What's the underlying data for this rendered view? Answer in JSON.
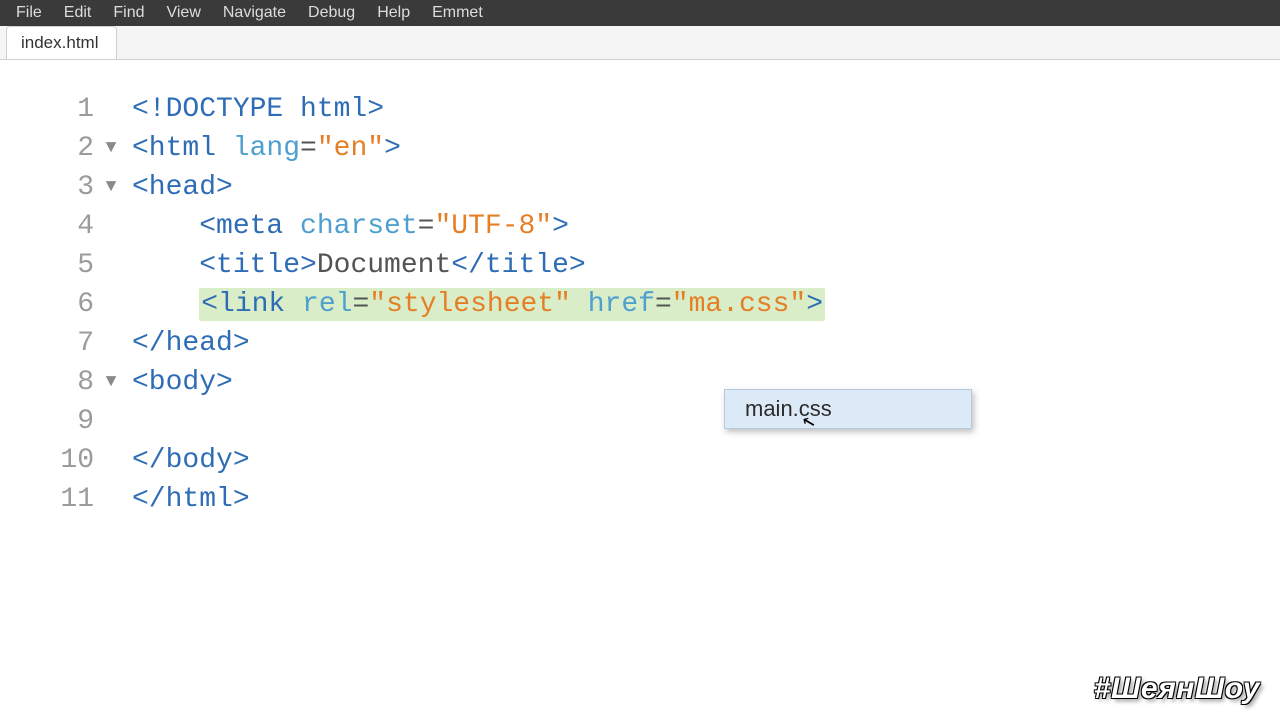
{
  "menu": {
    "items": [
      "File",
      "Edit",
      "Find",
      "View",
      "Navigate",
      "Debug",
      "Help",
      "Emmet"
    ]
  },
  "tabs": {
    "active": "index.html"
  },
  "code": {
    "lines": [
      {
        "num": "1",
        "fold": false
      },
      {
        "num": "2",
        "fold": true
      },
      {
        "num": "3",
        "fold": true
      },
      {
        "num": "4",
        "fold": false
      },
      {
        "num": "5",
        "fold": false
      },
      {
        "num": "6",
        "fold": false
      },
      {
        "num": "7",
        "fold": false
      },
      {
        "num": "8",
        "fold": true
      },
      {
        "num": "9",
        "fold": false
      },
      {
        "num": "10",
        "fold": false
      },
      {
        "num": "11",
        "fold": false
      }
    ],
    "tokens": {
      "l1_a": "<!DOCTYPE html>",
      "l2_a": "<html ",
      "l2_b": "lang",
      "l2_c": "=",
      "l2_d": "\"en\"",
      "l2_e": ">",
      "l3_a": "<head>",
      "l4_pad": "    ",
      "l4_a": "<meta ",
      "l4_b": "charset",
      "l4_c": "=",
      "l4_d": "\"UTF-8\"",
      "l4_e": ">",
      "l5_pad": "    ",
      "l5_a": "<title>",
      "l5_b": "Document",
      "l5_c": "</title>",
      "l6_pad": "    ",
      "l6_a": "<link ",
      "l6_b": "rel",
      "l6_c": "=",
      "l6_d": "\"stylesheet\"",
      "l6_sp": " ",
      "l6_e": "href",
      "l6_f": "=",
      "l6_g": "\"ma.css\"",
      "l6_h": ">",
      "l7_a": "</head>",
      "l8_a": "<body>",
      "l9_a": "",
      "l10_a": "</body>",
      "l11_a": "</html>"
    }
  },
  "autocomplete": {
    "items": [
      "main.css"
    ]
  },
  "watermark": "#ШеянШоу",
  "fold_glyph": "▼",
  "cursor_glyph": "↖"
}
